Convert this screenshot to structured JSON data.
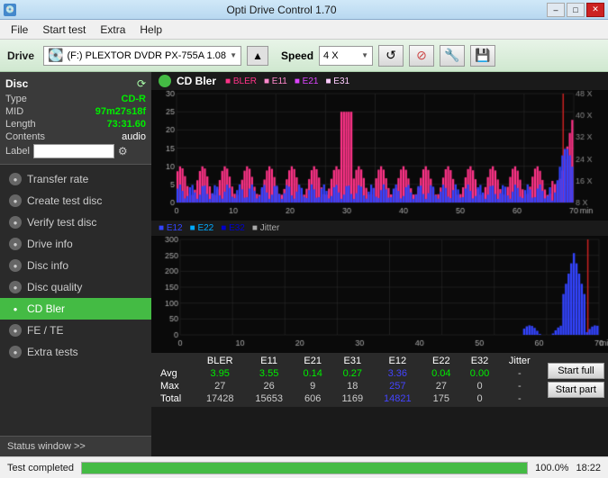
{
  "titlebar": {
    "title": "Opti Drive Control 1.70",
    "icon": "💿",
    "min_label": "–",
    "max_label": "□",
    "close_label": "✕"
  },
  "menubar": {
    "items": [
      "File",
      "Start test",
      "Extra",
      "Help"
    ]
  },
  "toolbar": {
    "drive_label": "Drive",
    "drive_value": "(F:)  PLEXTOR DVDR  PX-755A 1.08",
    "speed_label": "Speed",
    "speed_value": "4 X",
    "eject_icon": "▲"
  },
  "disc": {
    "title": "Disc",
    "type_label": "Type",
    "type_value": "CD-R",
    "mid_label": "MID",
    "mid_value": "97m27s18f",
    "length_label": "Length",
    "length_value": "73:31.60",
    "contents_label": "Contents",
    "contents_value": "audio",
    "label_label": "Label",
    "label_value": ""
  },
  "nav": {
    "items": [
      {
        "id": "transfer-rate",
        "label": "Transfer rate",
        "active": false
      },
      {
        "id": "create-test-disc",
        "label": "Create test disc",
        "active": false
      },
      {
        "id": "verify-test-disc",
        "label": "Verify test disc",
        "active": false
      },
      {
        "id": "drive-info",
        "label": "Drive info",
        "active": false
      },
      {
        "id": "disc-info",
        "label": "Disc info",
        "active": false
      },
      {
        "id": "disc-quality",
        "label": "Disc quality",
        "active": false
      },
      {
        "id": "cd-bler",
        "label": "CD Bler",
        "active": true
      },
      {
        "id": "fe-te",
        "label": "FE / TE",
        "active": false
      },
      {
        "id": "extra-tests",
        "label": "Extra tests",
        "active": false
      }
    ]
  },
  "status_window": {
    "label": "Status window >>"
  },
  "chart1": {
    "title": "CD Bler",
    "legend": [
      {
        "label": "BLER",
        "color": "#ff44aa"
      },
      {
        "label": "E11",
        "color": "#ff44aa"
      },
      {
        "label": "E21",
        "color": "#ff44ff"
      },
      {
        "label": "E31",
        "color": "#ffaaff"
      }
    ],
    "y_max": 30,
    "y_labels": [
      "30",
      "25",
      "20",
      "15",
      "10",
      "5",
      "0"
    ],
    "x_labels": [
      "0",
      "10",
      "20",
      "30",
      "40",
      "50",
      "60",
      "70"
    ],
    "speed_labels": [
      "48 X",
      "40 X",
      "32 X",
      "24 X",
      "16 X",
      "8 X"
    ],
    "x_unit": "min"
  },
  "chart2": {
    "legend": [
      {
        "label": "E12",
        "color": "#0044ff"
      },
      {
        "label": "E22",
        "color": "#00aaff"
      },
      {
        "label": "E32",
        "color": "#0000aa"
      },
      {
        "label": "Jitter",
        "color": "#888888"
      }
    ],
    "y_max": 300,
    "y_labels": [
      "300",
      "250",
      "200",
      "150",
      "100",
      "50",
      "0"
    ],
    "x_labels": [
      "0",
      "10",
      "20",
      "30",
      "40",
      "50",
      "60",
      "70"
    ],
    "x_unit": "min"
  },
  "table": {
    "headers": [
      "",
      "BLER",
      "E11",
      "E21",
      "E31",
      "E12",
      "E22",
      "E32",
      "Jitter",
      ""
    ],
    "rows": [
      {
        "label": "Avg",
        "values": [
          "3.95",
          "3.55",
          "0.14",
          "0.27",
          "3.36",
          "0.04",
          "0.00",
          "-"
        ]
      },
      {
        "label": "Max",
        "values": [
          "27",
          "26",
          "9",
          "18",
          "257",
          "27",
          "0",
          "-"
        ]
      },
      {
        "label": "Total",
        "values": [
          "17428",
          "15653",
          "606",
          "1169",
          "14821",
          "175",
          "0",
          "-"
        ]
      }
    ]
  },
  "buttons": {
    "start_full": "Start full",
    "start_part": "Start part"
  },
  "statusbar": {
    "status_text": "Test completed",
    "progress": 100,
    "percent_text": "100.0%",
    "time_text": "18:22"
  },
  "colors": {
    "bler": "#ff3388",
    "e11": "#ff44aa",
    "e21": "#dd44ff",
    "e31": "#ffaaff",
    "e12": "#3344ff",
    "e22": "#00aaff",
    "e32": "#0000cc",
    "jitter": "#888888",
    "green_accent": "#44bb44",
    "red_line": "#cc2222"
  }
}
